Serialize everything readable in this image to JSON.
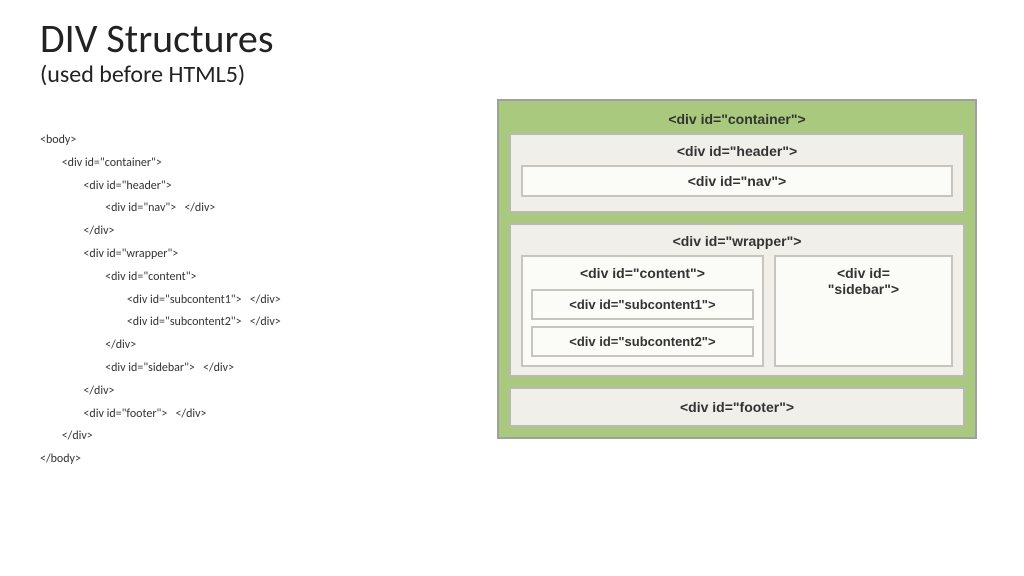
{
  "title": "DIV Structures",
  "subtitle": "(used before HTML5)",
  "code_lines": [
    "<body>",
    "        <div id=\"container\">",
    "                <div id=\"header\">",
    "                        <div id=\"nav\">   </div>",
    "                </div>",
    "                <div id=\"wrapper\">",
    "                        <div id=\"content\">",
    "                                <div id=\"subcontent1\">   </div>",
    "                                <div id=\"subcontent2\">   </div>",
    "                        </div>",
    "",
    "                        <div id=\"sidebar\">   </div>",
    "                </div>",
    "",
    "                <div id=\"footer\">   </div>",
    "        </div>",
    "</body>"
  ],
  "diagram": {
    "container": "<div id=\"container\">",
    "header": "<div id=\"header\">",
    "nav": "<div id=\"nav\">",
    "wrapper": "<div id=\"wrapper\">",
    "content": "<div id=\"content\">",
    "subcontent1": "<div id=\"subcontent1\">",
    "subcontent2": "<div id=\"subcontent2\">",
    "sidebar_line1": "<div id=",
    "sidebar_line2": "\"sidebar\">",
    "footer": "<div id=\"footer\">"
  }
}
